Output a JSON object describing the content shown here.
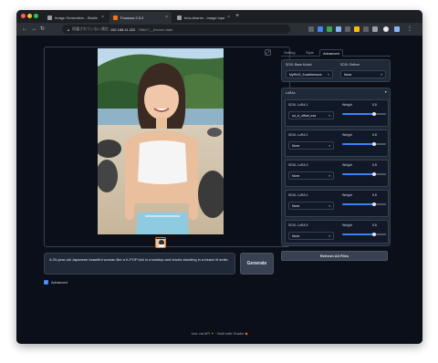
{
  "browser": {
    "tabs": [
      {
        "label": "Image Generation - Stable Diffus..."
      },
      {
        "label": "Fooocus 2.5.2"
      },
      {
        "label": "bria-cleaner - image inpainting"
      }
    ],
    "new_tab_icon": "+",
    "url": {
      "prefix": "保護されていない通信",
      "host": "192.168.11.222",
      "path": ":7860/?__theme=dark"
    }
  },
  "image_area": {
    "expand_icon": "expand-icon"
  },
  "prompt": {
    "value": "A 20-year-old Japanese beautiful woman like a K-POP idol in a tanktop and shorts standing in a beach lit smile."
  },
  "generate_label": "Generate",
  "advanced": {
    "label": "Advanced",
    "checked": true
  },
  "settings_tabs": [
    {
      "label": "Setting",
      "active": false
    },
    {
      "label": "Style",
      "active": false
    },
    {
      "label": "Advanced",
      "active": true
    }
  ],
  "base_model": {
    "label": "SDXL Base Model",
    "value": "MyRIoD_5.safetensors"
  },
  "refiner": {
    "label": "SDXL Refiner",
    "value": "None"
  },
  "loras": {
    "title": "LoRAs",
    "items": [
      {
        "label": "SDXL LoRA 1",
        "value": "sd_xl_offset_exa",
        "weight_label": "Weight",
        "weight": "0.5"
      },
      {
        "label": "SDXL LoRA 2",
        "value": "None",
        "weight_label": "Weight",
        "weight": "0.5"
      },
      {
        "label": "SDXL LoRA 3",
        "value": "None",
        "weight_label": "Weight",
        "weight": "0.5"
      },
      {
        "label": "SDXL LoRA 4",
        "value": "None",
        "weight_label": "Weight",
        "weight": "0.5"
      },
      {
        "label": "SDXL LoRA 5",
        "value": "None",
        "weight_label": "Weight",
        "weight": "0.5"
      }
    ]
  },
  "refresh_label": "Refresh All Files",
  "footer": {
    "api_text": "Use via API",
    "gradio_text": "Built with Gradio"
  },
  "colors": {
    "accent": "#3b82f6",
    "background": "#0b0f19",
    "panel": "#1f2937",
    "border": "#374151"
  }
}
